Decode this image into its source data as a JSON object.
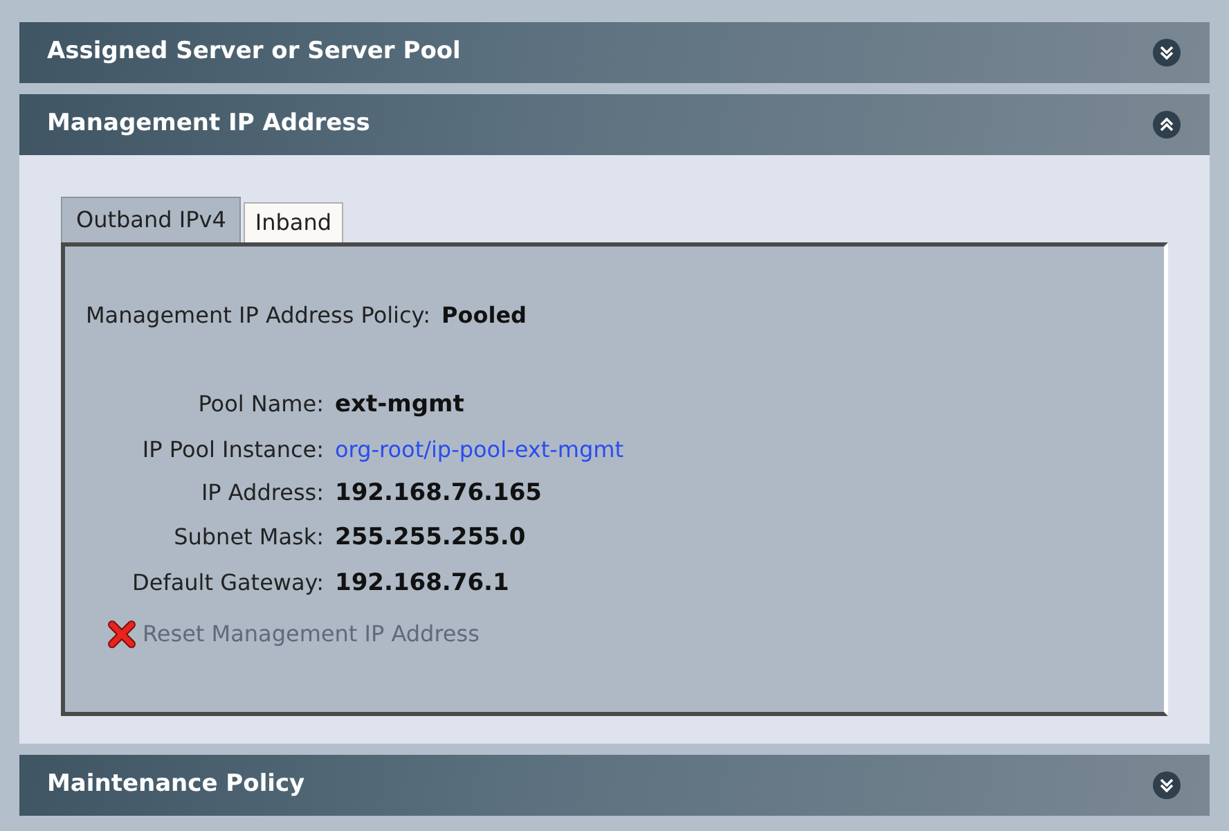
{
  "sections": [
    {
      "title": "Assigned Server or Server Pool",
      "expanded": false
    },
    {
      "title": "Management IP Address",
      "expanded": true,
      "tabs": [
        {
          "label": "Outband IPv4",
          "selected": true
        },
        {
          "label": "Inband",
          "selected": false
        }
      ],
      "policy": {
        "label": "Management IP Address Policy:",
        "value": "Pooled"
      },
      "fields": [
        {
          "label": "Pool Name:",
          "value": "ext-mgmt",
          "kind": "text"
        },
        {
          "label": "IP Pool Instance:",
          "value": "org-root/ip-pool-ext-mgmt",
          "kind": "link"
        },
        {
          "label": "IP Address:",
          "value": "192.168.76.165",
          "kind": "text"
        },
        {
          "label": "Subnet Mask:",
          "value": "255.255.255.0",
          "kind": "text"
        },
        {
          "label": "Default Gateway:",
          "value": "192.168.76.1",
          "kind": "text"
        }
      ],
      "action": {
        "label": "Reset Management IP Address",
        "disabled": true
      }
    },
    {
      "title": "Maintenance Policy",
      "expanded": false
    }
  ]
}
